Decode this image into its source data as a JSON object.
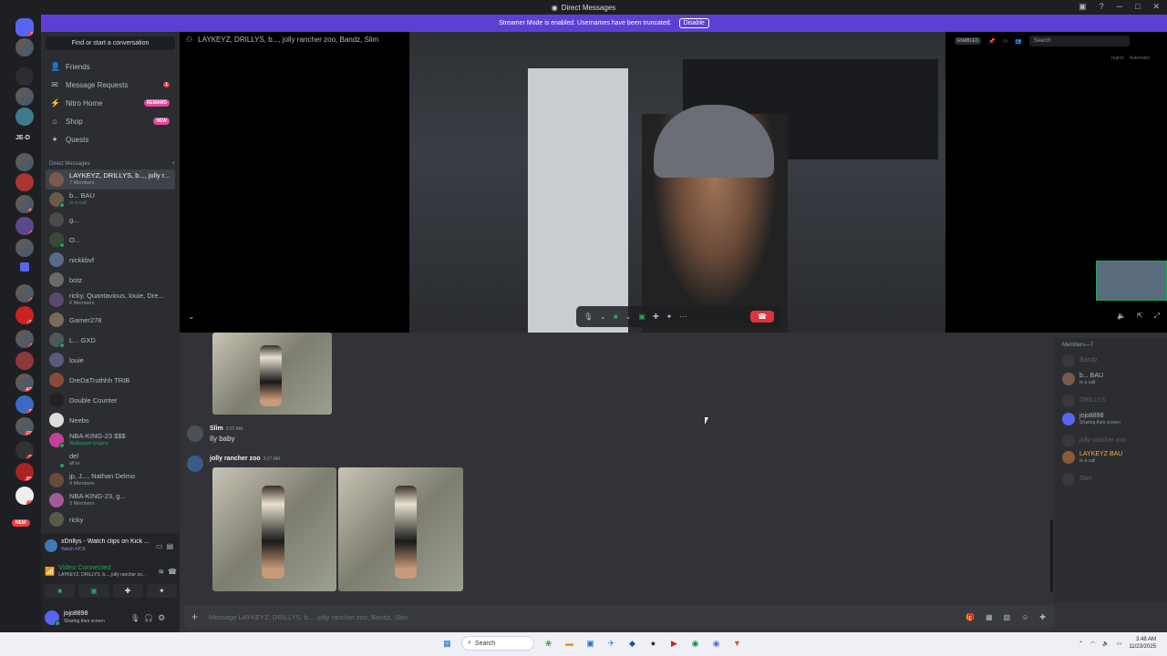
{
  "window": {
    "title": "Direct Messages"
  },
  "streamer_banner": {
    "text": "Streamer Mode is enabled. Usernames have been truncated.",
    "button": "Disable"
  },
  "servers": {
    "label_jed": "JE-D",
    "new_label": "NEW",
    "badges": [
      "1",
      "11",
      "1",
      "3",
      "21",
      "2",
      "479",
      "73",
      "128",
      "76",
      "256",
      "13"
    ]
  },
  "sidebar": {
    "find": "Find or start a conversation",
    "nav": [
      {
        "label": "Friends",
        "icon": "friends-icon"
      },
      {
        "label": "Message Requests",
        "icon": "envelope-icon",
        "tag": "1"
      },
      {
        "label": "Nitro Home",
        "icon": "nitro-icon",
        "tag": "REWARD"
      },
      {
        "label": "Shop",
        "icon": "shop-icon",
        "tag": "NEW"
      },
      {
        "label": "Quests",
        "icon": "quests-icon"
      }
    ],
    "dm_header": "Direct Messages",
    "dm_add": "+",
    "dms": [
      {
        "name": "LAYKEYZ, DRILLYS, b..., jolly r...",
        "sub": "7 Members"
      },
      {
        "name": "b... BAU",
        "sub": "In a call"
      },
      {
        "name": "g...",
        "sub": ""
      },
      {
        "name": "O...",
        "sub": ""
      },
      {
        "name": "nickkbvf",
        "sub": ""
      },
      {
        "name": "botz",
        "sub": ""
      },
      {
        "name": "ricky, Quantavious, louie, Dre...",
        "sub": "6 Members"
      },
      {
        "name": "Gamer278",
        "sub": ""
      },
      {
        "name": "L... GXD",
        "sub": ""
      },
      {
        "name": "louie",
        "sub": ""
      },
      {
        "name": "DreDaTruthhh TRIB",
        "sub": ""
      },
      {
        "name": "Double Counter",
        "sub": ""
      },
      {
        "name": "Neebs",
        "sub": ""
      },
      {
        "name": "NBA-KING-23 $$$",
        "sub": "Wallpaper Engine"
      },
      {
        "name": "del",
        "sub": "all in"
      },
      {
        "name": "jp, J..., Nathan Delmo",
        "sub": "4 Members"
      },
      {
        "name": "NBA-KING-23, g...",
        "sub": "3 Members"
      },
      {
        "name": "ricky",
        "sub": ""
      }
    ]
  },
  "user_panel": {
    "stream_title": "xDrillys - Watch clips on Kick ...",
    "stream_sub": "Watch KICK",
    "voice_status": "Video Connected",
    "voice_channel": "LAYKEYZ, DRILLYS, b..., jolly rancher zo...",
    "username": "jojo8898",
    "user_status": "Sharing their screen"
  },
  "call": {
    "header": "LAYKEYZ, DRILLYS, b..., jolly rancher zoo, Bandz, Slim",
    "enabled": "ENABLED",
    "search_placeholder": "Search",
    "region": "region",
    "region_value": "Automatic"
  },
  "messages": [
    {
      "author": "Slim",
      "time": "3:37 AM",
      "text": "Ily baby"
    },
    {
      "author": "jolly rancher zoo",
      "time": "3:37 AM",
      "text": ""
    }
  ],
  "members": {
    "header": "Members—7",
    "list": [
      {
        "name": "Bandz",
        "status": ""
      },
      {
        "name": "b... BAU",
        "status": "In a call"
      },
      {
        "name": "DRILLYS",
        "status": ""
      },
      {
        "name": "jojo8898",
        "status": "Sharing their screen"
      },
      {
        "name": "jolly rancher zoo",
        "status": ""
      },
      {
        "name": "LAYKEYZ BAU",
        "status": "In a call"
      },
      {
        "name": "Slim",
        "status": ""
      }
    ]
  },
  "composer": {
    "placeholder": "Message LAYKEYZ, DRILLYS, b..., jolly rancher zoo, Bandz, Slim"
  },
  "taskbar": {
    "search": "Search",
    "time": "3:48 AM",
    "date": "11/23/2025"
  },
  "colors": {
    "accent": "#5865f2",
    "banner": "#5e3fd6",
    "online": "#23a55a",
    "danger": "#da373c"
  }
}
